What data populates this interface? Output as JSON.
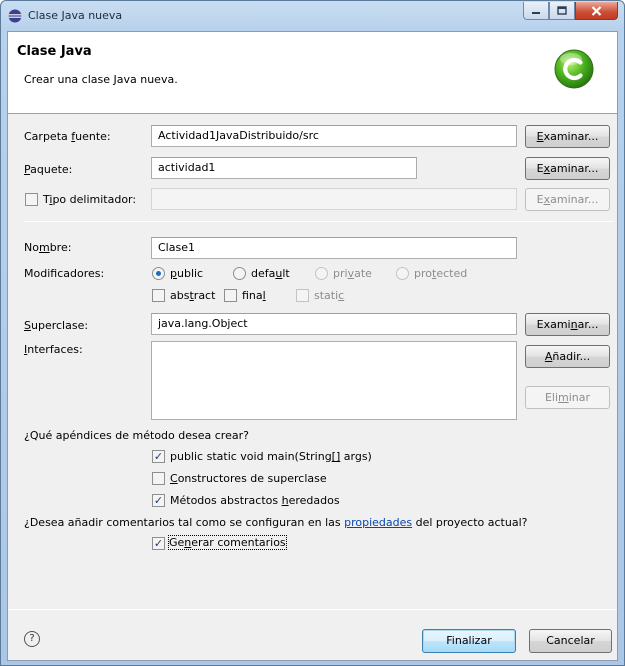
{
  "window": {
    "title": "Clase Java nueva"
  },
  "header": {
    "title": "Clase Java",
    "description": "Crear una clase Java nueva."
  },
  "source_folder": {
    "label_pre": "Carpeta ",
    "label_u": "f",
    "label_post": "uente:",
    "value": "Actividad1JavaDistribuido/src",
    "browse_pre": "",
    "browse_u": "E",
    "browse_post": "xaminar..."
  },
  "package": {
    "label_pre": "",
    "label_u": "P",
    "label_post": "aquete:",
    "value": "actividad1",
    "browse_pre": "E",
    "browse_u": "x",
    "browse_post": "aminar..."
  },
  "enclosing_type": {
    "label_pre": "T",
    "label_u": "i",
    "label_post": "po delimitador:",
    "value": "",
    "browse_pre": "E",
    "browse_u": "x",
    "browse_post": "aminar..."
  },
  "name": {
    "label_pre": "No",
    "label_u": "m",
    "label_post": "bre:",
    "value": "Clase1"
  },
  "modifiers": {
    "label": "Modificadores:",
    "public_u": "p",
    "public_post": "ublic",
    "default_pre": "defa",
    "default_u": "u",
    "default_post": "lt",
    "private_pre": "pri",
    "private_u": "v",
    "private_post": "ate",
    "protected_pre": "pro",
    "protected_u": "t",
    "protected_post": "ected",
    "abstract_pre": "abs",
    "abstract_u": "t",
    "abstract_post": "ract",
    "final_pre": "fina",
    "final_u": "l",
    "final_post": "",
    "static_pre": "stati",
    "static_u": "c",
    "static_post": "",
    "selected": "public"
  },
  "superclass": {
    "label_pre": "",
    "label_u": "S",
    "label_post": "uperclase:",
    "value": "java.lang.Object",
    "browse_pre": "Exami",
    "browse_u": "n",
    "browse_post": "ar..."
  },
  "interfaces": {
    "label_pre": "",
    "label_u": "I",
    "label_post": "nterfaces:",
    "add_pre": "",
    "add_u": "A",
    "add_post": "ñadir...",
    "remove_pre": "Eli",
    "remove_u": "m",
    "remove_post": "inar"
  },
  "stubs": {
    "question": "¿Qué apéndices de método desea crear?",
    "main_pre": "public static void main(String",
    "main_u": "[]",
    "main_post": " args)",
    "ctor_pre": "",
    "ctor_u": "C",
    "ctor_post": "onstructores de superclase",
    "inherited_pre": "Métodos abstractos ",
    "inherited_u": "h",
    "inherited_post": "eredados",
    "main_checked": true,
    "ctor_checked": false,
    "inherited_checked": true
  },
  "comments": {
    "question_pre": "¿Desea añadir comentarios tal como se configuran en las ",
    "question_link": "propiedades",
    "question_post": " del proyecto actual?",
    "generate_pre": "Ge",
    "generate_u": "n",
    "generate_post": "erar comentarios",
    "checked": true
  },
  "footer": {
    "help_glyph": "?",
    "finish_label": "Finalizar",
    "cancel_label": "Cancelar"
  }
}
